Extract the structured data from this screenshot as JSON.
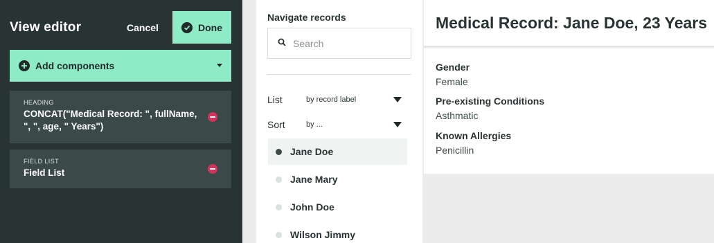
{
  "editor": {
    "title": "View editor",
    "cancel_label": "Cancel",
    "done_label": "Done",
    "add_components_label": "Add components",
    "components": [
      {
        "type": "HEADING",
        "value": "CONCAT(\"Medical Record: \", fullName, \", \", age, \" Years\")"
      },
      {
        "type": "FIELD LIST",
        "value": "Field List"
      }
    ]
  },
  "navigator": {
    "title": "Navigate records",
    "search_placeholder": "Search",
    "list_label": "List",
    "list_value": "by record label",
    "sort_label": "Sort",
    "sort_value": "by ...",
    "records": [
      "Jane Doe",
      "Jane Mary",
      "John Doe",
      "Wilson Jimmy"
    ],
    "active_record": "Jane Doe"
  },
  "record": {
    "title": "Medical Record: Jane Doe, 23 Years",
    "fields": [
      {
        "label": "Gender",
        "value": "Female"
      },
      {
        "label": "Pre-existing Conditions",
        "value": "Asthmatic"
      },
      {
        "label": "Known Allergies",
        "value": "Penicillin"
      }
    ]
  },
  "colors": {
    "editor_bg": "#283433",
    "accent": "#8eebc6",
    "card_bg": "#3b4948",
    "remove": "#d1325b"
  },
  "icons": [
    "check-circle-icon",
    "plus-circle-icon",
    "chevron-down-icon",
    "search-icon",
    "minus-circle-icon",
    "triangle-down-icon",
    "bullet-dot-icon"
  ]
}
